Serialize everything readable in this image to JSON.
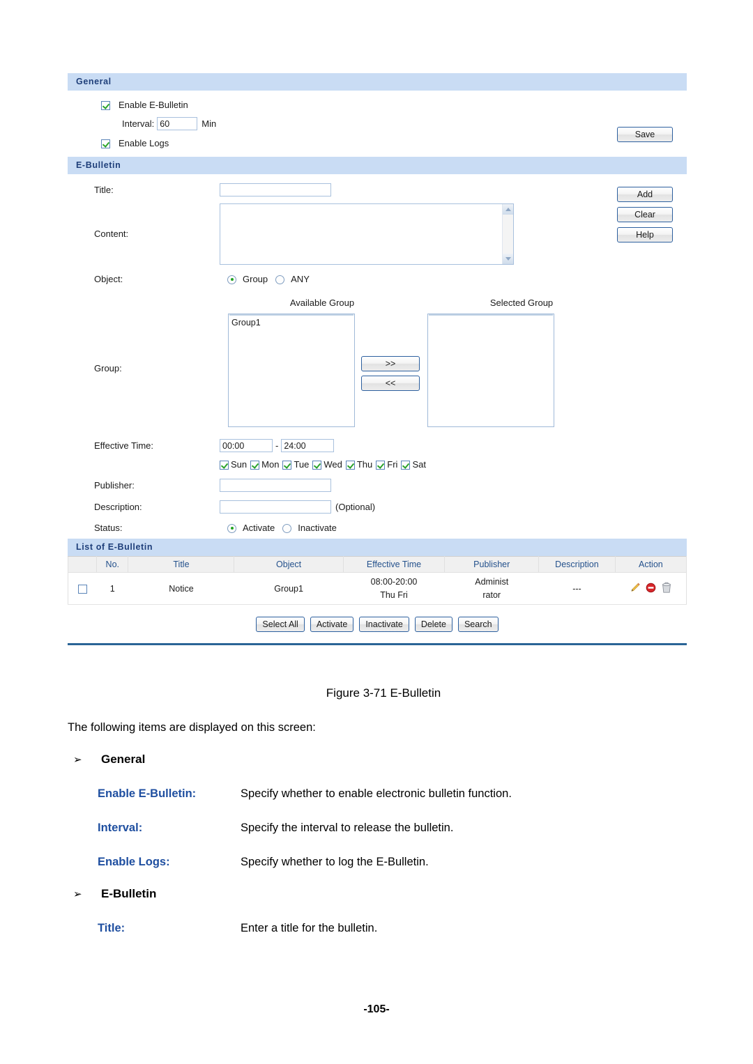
{
  "general": {
    "header": "General",
    "enable_bulletin_label": "Enable E-Bulletin",
    "enable_bulletin_checked": true,
    "interval_label": "Interval:",
    "interval_value": "60",
    "interval_unit": "Min",
    "enable_logs_label": "Enable Logs",
    "enable_logs_checked": true,
    "save_button": "Save"
  },
  "ebulletin": {
    "header": "E-Bulletin",
    "title_label": "Title:",
    "title_value": "",
    "content_label": "Content:",
    "content_value": "",
    "object_label": "Object:",
    "object_options": [
      "Group",
      "ANY"
    ],
    "object_selected": "Group",
    "group_label": "Group:",
    "available_group_label": "Available Group",
    "selected_group_label": "Selected Group",
    "available_groups": [
      "Group1"
    ],
    "selected_groups": [],
    "move_right_button": ">>",
    "move_left_button": "<<",
    "effective_time_label": "Effective Time:",
    "effective_time_start": "00:00",
    "effective_time_separator": "-",
    "effective_time_end": "24:00",
    "days": [
      {
        "label": "Sun",
        "checked": true
      },
      {
        "label": "Mon",
        "checked": true
      },
      {
        "label": "Tue",
        "checked": true
      },
      {
        "label": "Wed",
        "checked": true
      },
      {
        "label": "Thu",
        "checked": true
      },
      {
        "label": "Fri",
        "checked": true
      },
      {
        "label": "Sat",
        "checked": true
      }
    ],
    "publisher_label": "Publisher:",
    "publisher_value": "",
    "description_label": "Description:",
    "description_value": "",
    "description_hint": "(Optional)",
    "status_label": "Status:",
    "status_options": [
      "Activate",
      "Inactivate"
    ],
    "status_selected": "Activate",
    "add_button": "Add",
    "clear_button": "Clear",
    "help_button": "Help"
  },
  "list": {
    "header": "List of E-Bulletin",
    "columns": [
      "",
      "No.",
      "Title",
      "Object",
      "Effective Time",
      "Publisher",
      "Description",
      "Action"
    ],
    "rows": [
      {
        "selected": false,
        "no": "1",
        "title": "Notice",
        "object": "Group1",
        "effective_time_line1": "08:00-20:00",
        "effective_time_line2": "Thu Fri",
        "publisher_line1": "Administ",
        "publisher_line2": "rator",
        "description": "---",
        "actions": [
          "edit-icon",
          "disable-icon",
          "delete-icon"
        ]
      }
    ],
    "buttons": [
      "Select All",
      "Activate",
      "Inactivate",
      "Delete",
      "Search"
    ]
  },
  "document": {
    "figure_caption": "Figure 3-71 E-Bulletin",
    "intro": "The following items are displayed on this screen:",
    "sections": [
      {
        "bullet": "➢",
        "heading": "General",
        "items": [
          {
            "term": "Enable E-Bulletin:",
            "desc": "Specify whether to enable electronic bulletin function."
          },
          {
            "term": "Interval:",
            "desc": "Specify the interval to release the bulletin."
          },
          {
            "term": "Enable Logs:",
            "desc": "Specify whether to log the E-Bulletin."
          }
        ]
      },
      {
        "bullet": "➢",
        "heading": "E-Bulletin",
        "items": [
          {
            "term": "Title:",
            "desc": "Enter a title for the bulletin."
          }
        ]
      }
    ],
    "page_number": "-105-"
  },
  "colors": {
    "section_header_bg": "#c9dcf4",
    "section_header_text": "#1f3f7a",
    "accent_blue": "#1f4fa0",
    "divider_blue": "#2a6496",
    "check_green": "#2aa32a",
    "edit_icon": "#e8a33d",
    "disable_icon": "#d42a2a",
    "delete_icon": "#9aa0a6"
  }
}
